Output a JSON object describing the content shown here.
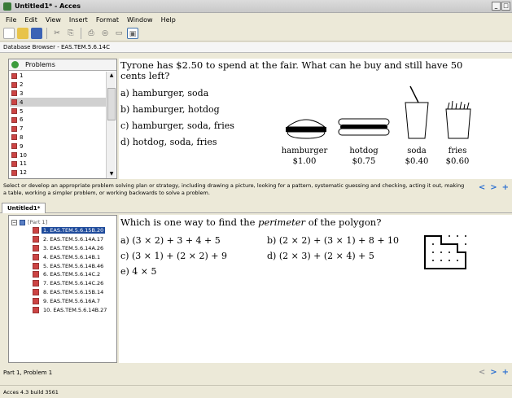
{
  "window": {
    "title": "Untitled1* - Acces",
    "btn_min": "_",
    "btn_max": "□"
  },
  "menu": [
    {
      "label": "File",
      "ul": "F"
    },
    {
      "label": "Edit",
      "ul": "E"
    },
    {
      "label": "View",
      "ul": "V"
    },
    {
      "label": "Insert",
      "ul": "I"
    },
    {
      "label": "Format",
      "ul": "o"
    },
    {
      "label": "Window",
      "ul": "W"
    },
    {
      "label": "Help",
      "ul": "H"
    }
  ],
  "db_browser": "Database Browser - EAS.TEM.5.6.14C",
  "problems_panel": {
    "title": "Problems",
    "items": [
      "1",
      "2",
      "3",
      "4",
      "5",
      "6",
      "7",
      "8",
      "9",
      "10",
      "11",
      "12"
    ],
    "selected_index": 3
  },
  "problem1": {
    "question": "Tyrone has $2.50 to spend at the fair.  What can he buy and still have 50 cents left?",
    "options": [
      "a)  hamburger, soda",
      "b)  hamburger, hotdog",
      "c)  hamburger, soda, fries",
      "d)  hotdog, soda, fries"
    ],
    "foods": [
      {
        "name": "hamburger",
        "price": "$1.00"
      },
      {
        "name": "hotdog",
        "price": "$0.75"
      },
      {
        "name": "soda",
        "price": "$0.40"
      },
      {
        "name": "fries",
        "price": "$0.60"
      }
    ]
  },
  "strategy_text": "Select or develop an appropriate problem solving plan or strategy, including drawing a picture, looking for a pattern, systematic guessing and checking, acting it out, making a table, working a simpler problem, or working backwards to solve a problem.",
  "doc_tab": "Untitled1*",
  "tree": {
    "root": "[Part 1]",
    "items": [
      "1. EAS.TEM.5.6.15B.20",
      "2. EAS.TEM.5.6.14A.17",
      "3. EAS.TEM.5.6.14A.26",
      "4. EAS.TEM.5.6.14B.1",
      "5. EAS.TEM.5.6.14B.46",
      "6. EAS.TEM.5.6.14C.2",
      "7. EAS.TEM.5.6.14C.26",
      "8. EAS.TEM.5.6.15B.14",
      "9. EAS.TEM.5.6.16A.7",
      "10. EAS.TEM.5.6.14B.27"
    ],
    "selected_index": 0
  },
  "problem2": {
    "question_pre": "Which is one way to find the ",
    "question_em": "perimeter",
    "question_post": " of the polygon?",
    "options": {
      "a": "a)  (3 × 2) + 3 + 4 + 5",
      "b": "b)  (2 × 2) + (3 × 1) + 8 + 10",
      "c": "c)  (3 × 1) + (2 × 2) + 9",
      "d": "d)  (2 × 3) + (2 × 4) + 5",
      "e": "e)  4 × 5"
    }
  },
  "part_label": "Part 1, Problem 1",
  "status": "Acces 4.3 build 3561",
  "colors": {
    "accent": "#2b6fd1",
    "selection": "#1d4a9b"
  }
}
